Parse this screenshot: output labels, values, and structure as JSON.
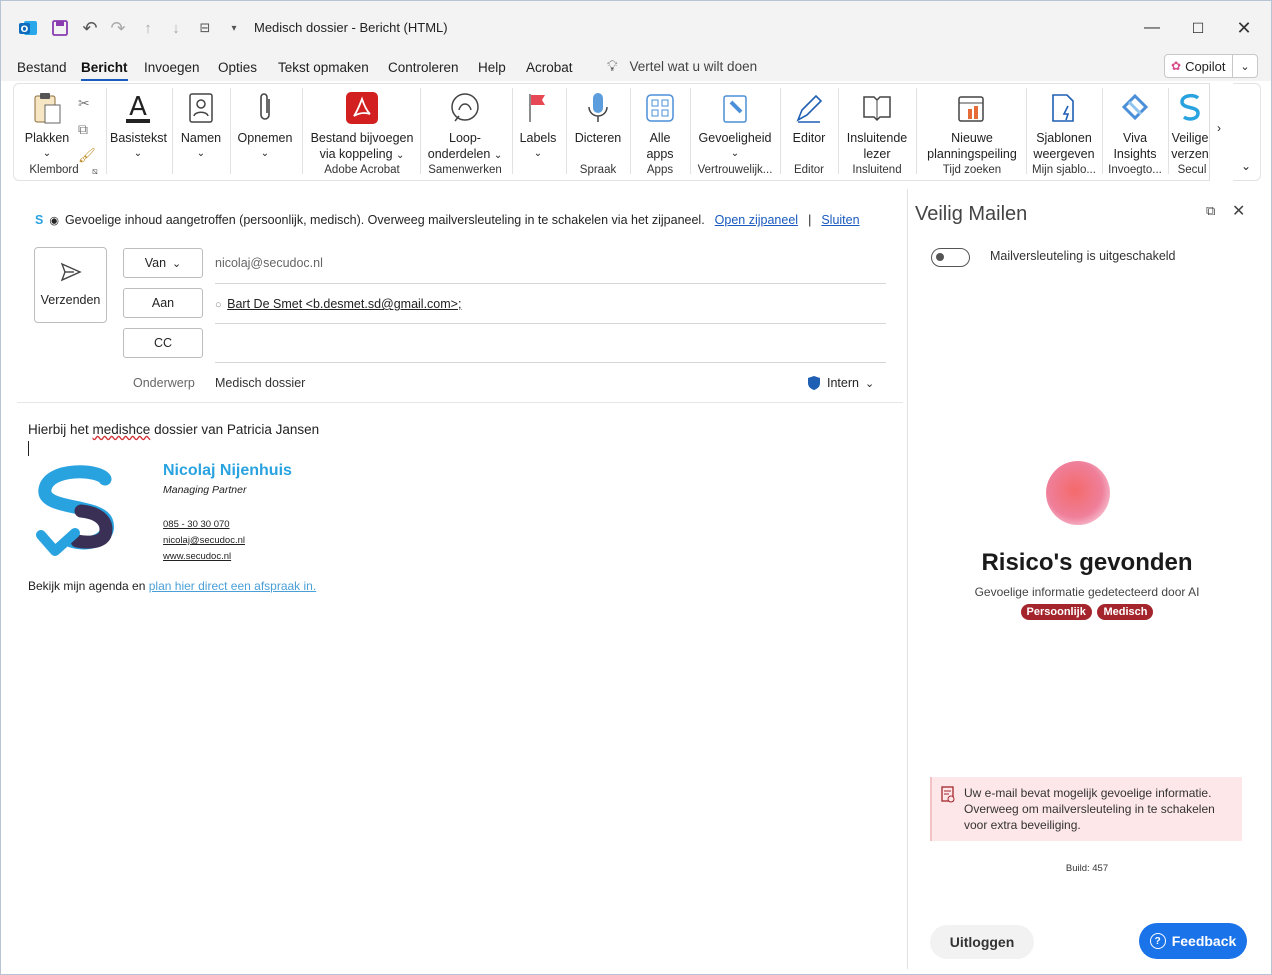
{
  "titlebar": {
    "title": "Medisch dossier  -  Bericht (HTML)"
  },
  "menu": {
    "items": [
      "Bestand",
      "Bericht",
      "Invoegen",
      "Opties",
      "Tekst opmaken",
      "Controleren",
      "Help",
      "Acrobat"
    ],
    "active": "Bericht",
    "tellme": "Vertel wat u wilt doen",
    "copilot": "Copilot"
  },
  "ribbon": {
    "plakken": "Plakken",
    "basistekst": "Basistekst",
    "namen": "Namen",
    "opnemen": "Opnemen",
    "acrobat_l1": "Bestand bijvoegen",
    "acrobat_l2": "via koppeling",
    "loop_l1": "Loop-",
    "loop_l2": "onderdelen",
    "labels": "Labels",
    "dicteren": "Dicteren",
    "alle_l1": "Alle",
    "alle_l2": "apps",
    "gevoeligheid": "Gevoeligheid",
    "editor": "Editor",
    "insl_l1": "Insluitende",
    "insl_l2": "lezer",
    "nieuw_l1": "Nieuwe",
    "nieuw_l2": "planningspeiling",
    "sjab_l1": "Sjablonen",
    "sjab_l2": "weergeven",
    "viva_l1": "Viva",
    "viva_l2": "Insights",
    "veilig_l1": "Veilige",
    "veilig_l2": "verzen",
    "groups": {
      "klembord": "Klembord",
      "adobe": "Adobe Acrobat",
      "samenwerken": "Samenwerken",
      "spraak": "Spraak",
      "apps": "Apps",
      "vertrouwelijk": "Vertrouwelijk...",
      "editor": "Editor",
      "insluitend": "Insluitend",
      "tijd": "Tijd zoeken",
      "mijn": "Mijn sjablo...",
      "invoeg": "Invoegto...",
      "secu": "Secul"
    }
  },
  "notice": {
    "text": "Gevoelige inhoud aangetroffen (persoonlijk, medisch). Overweeg mailversleuteling in te schakelen via het zijpaneel.",
    "open": "Open zijpaneel",
    "sep": "|",
    "close": "Sluiten"
  },
  "compose": {
    "send": "Verzenden",
    "from_label": "Van",
    "from_value": "nicolaj@secudoc.nl",
    "to_label": "Aan",
    "to_value": "Bart De Smet <b.desmet.sd@gmail.com>;",
    "cc_label": "CC",
    "subject_label": "Onderwerp",
    "subject_value": "Medisch dossier",
    "sensitivity": "Intern"
  },
  "body": {
    "line1_a": "Hierbij het ",
    "line1_misspelled": "medishce",
    "line1_b": " dossier van Patricia Jansen",
    "sig_name": "Nicolaj Nijenhuis",
    "sig_role": "Managing Partner",
    "sig_phone": "085 - 30 30 070",
    "sig_email": "nicolaj@secudoc.nl",
    "sig_web": "www.secudoc.nl",
    "agenda_text": "Bekijk mijn agenda en ",
    "agenda_link": "plan hier direct een afspraak in."
  },
  "pane": {
    "title": "Veilig Mailen",
    "toggle_label": "Mailversleuteling is uitgeschakeld",
    "risk_title": "Risico's gevonden",
    "risk_sub": "Gevoelige informatie gedetecteerd door AI",
    "chips": [
      "Persoonlijk",
      "Medisch"
    ],
    "warning": "Uw e-mail bevat mogelijk gevoelige informatie. Overweeg om mailversleuteling in te schakelen voor extra beveiliging.",
    "build": "Build: 457",
    "logout": "Uitloggen",
    "feedback": "Feedback"
  },
  "colors": {
    "accent": "#185abd",
    "risk": "#a4262c",
    "feedback": "#1a73e8",
    "warning_bg": "#fde7e9"
  }
}
